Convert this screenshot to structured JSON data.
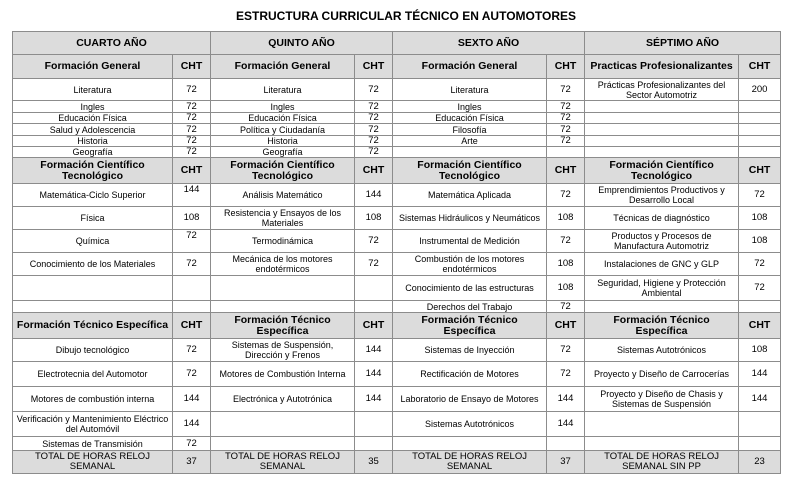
{
  "title": "ESTRUCTURA CURRICULAR TÉCNICO EN AUTOMOTORES",
  "years": [
    "CUARTO AÑO",
    "QUINTO AÑO",
    "SEXTO AÑO",
    "SÉPTIMO AÑO"
  ],
  "cht": "CHT",
  "sec1": [
    "Formación General",
    "Formación General",
    "Formación General",
    "Practicas Profesionalizantes"
  ],
  "general": [
    [
      "Literatura",
      "72",
      "Literatura",
      "72",
      "Literatura",
      "72",
      "Prácticas Profesionalizantes del Sector Automotriz",
      "200"
    ],
    [
      "Ingles",
      "72",
      "Ingles",
      "72",
      "Ingles",
      "72",
      "",
      ""
    ],
    [
      "Educación Física",
      "72",
      "Educación Física",
      "72",
      "Educación Física",
      "72",
      "",
      ""
    ],
    [
      "Salud y Adolescencia",
      "72",
      "Política y Ciudadanía",
      "72",
      "Filosofía",
      "72",
      "",
      ""
    ],
    [
      "Historia",
      "72",
      "Historia",
      "72",
      "Arte",
      "72",
      "",
      ""
    ],
    [
      "Geografía",
      "72",
      "Geografía",
      "72",
      "",
      "",
      "",
      ""
    ]
  ],
  "sec2": [
    "Formación Científico Tecnológico",
    "Formación Científico Tecnológico",
    "Formación Científico Tecnológico",
    "Formación Científico Tecnológico"
  ],
  "scientific": [
    [
      "Matemática-Ciclo Superior",
      "144",
      "Análisis Matemático",
      "144",
      "Matemática Aplicada",
      "72",
      "Emprendimientos Productivos y Desarrollo Local",
      "72"
    ],
    [
      "Física",
      "108",
      "Resistencia y Ensayos de los Materiales",
      "108",
      "Sistemas Hidráulicos y Neumáticos",
      "108",
      "Técnicas de diagnóstico",
      "108"
    ],
    [
      "Química",
      "72",
      "Termodinámica",
      "72",
      "Instrumental de Medición",
      "72",
      "Productos y Procesos de Manufactura Automotriz",
      "108"
    ],
    [
      "Conocimiento de los Materiales",
      "72",
      "Mecánica de los motores endotérmicos",
      "72",
      "Combustión de los motores endotérmicos",
      "108",
      "Instalaciones de GNC y GLP",
      "72"
    ],
    [
      "",
      "",
      "",
      "",
      "Conocimiento de las estructuras",
      "108",
      "Seguridad, Higiene y Protección Ambiental",
      "72"
    ],
    [
      "",
      "",
      "",
      "",
      "Derechos del Trabajo",
      "72",
      "",
      ""
    ]
  ],
  "sec3": [
    "Formación Técnico Específica",
    "Formación Técnico Específica",
    "Formación Técnico Específica",
    "Formación Técnico Específica"
  ],
  "technical": [
    [
      "Dibujo tecnológico",
      "72",
      "Sistemas de Suspensión, Dirección y Frenos",
      "144",
      "Sistemas de Inyección",
      "72",
      "Sistemas Autotrónicos",
      "108"
    ],
    [
      "Electrotecnia del Automotor",
      "72",
      "Motores de Combustión Interna",
      "144",
      "Rectificación de Motores",
      "72",
      "Proyecto y Diseño de Carrocerías",
      "144"
    ],
    [
      "Motores de combustión interna",
      "144",
      "Electrónica y Autotrónica",
      "144",
      "Laboratorio de Ensayo de Motores",
      "144",
      "Proyecto y Diseño de Chasis y Sistemas de Suspensión",
      "144"
    ],
    [
      "Verificación y Mantenimiento Eléctrico del Automóvil",
      "144",
      "",
      "",
      "Sistemas Autotrónicos",
      "144",
      "",
      ""
    ],
    [
      "Sistemas de Transmisión",
      "72",
      "",
      "",
      "",
      "",
      "",
      ""
    ]
  ],
  "totals": [
    "TOTAL DE HORAS RELOJ SEMANAL",
    "37",
    "TOTAL DE HORAS RELOJ SEMANAL",
    "35",
    "TOTAL DE HORAS RELOJ SEMANAL",
    "37",
    "TOTAL DE HORAS RELOJ SEMANAL SIN PP",
    "23"
  ]
}
